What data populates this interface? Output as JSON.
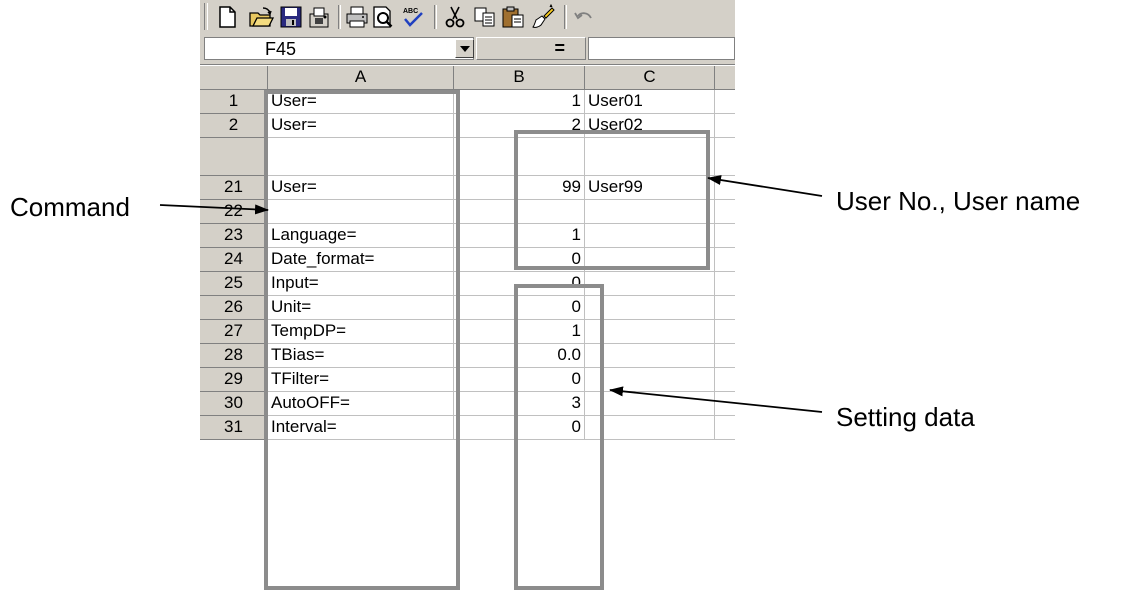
{
  "namebox": {
    "value": "F45"
  },
  "formula_bar": {
    "equals_label": "="
  },
  "columns": [
    "A",
    "B",
    "C"
  ],
  "rows": [
    {
      "num": "1",
      "a": "User=",
      "b": "1",
      "c": "User01"
    },
    {
      "num": "2",
      "a": "User=",
      "b": "2",
      "c": "User02"
    },
    {
      "num": "",
      "a": "",
      "b": "",
      "c": ""
    },
    {
      "num": "21",
      "a": "User=",
      "b": "99",
      "c": "User99"
    },
    {
      "num": "22",
      "a": "",
      "b": "",
      "c": ""
    },
    {
      "num": "23",
      "a": "Language=",
      "b": "1",
      "c": ""
    },
    {
      "num": "24",
      "a": "Date_format=",
      "b": "0",
      "c": ""
    },
    {
      "num": "25",
      "a": "Input=",
      "b": "0",
      "c": ""
    },
    {
      "num": "26",
      "a": "Unit=",
      "b": "0",
      "c": ""
    },
    {
      "num": "27",
      "a": "TempDP=",
      "b": "1",
      "c": ""
    },
    {
      "num": "28",
      "a": "TBias=",
      "b": "0.0",
      "c": ""
    },
    {
      "num": "29",
      "a": "TFilter=",
      "b": "0",
      "c": ""
    },
    {
      "num": "30",
      "a": "AutoOFF=",
      "b": "3",
      "c": ""
    },
    {
      "num": "31",
      "a": "Interval=",
      "b": "0",
      "c": ""
    }
  ],
  "callouts": {
    "command": "Command",
    "user": "User No., User name",
    "setting": "Setting data"
  },
  "toolbar_icons": [
    "new-icon",
    "open-icon",
    "save-icon",
    "permission-icon",
    "print-icon",
    "print-preview-icon",
    "spell-check-icon",
    "cut-icon",
    "copy-icon",
    "paste-icon",
    "format-painter-icon",
    "undo-icon"
  ],
  "colors": {
    "chrome": "#d4d0c8",
    "group_border": "#8c8c8c",
    "gridline": "#c0c0c0"
  }
}
